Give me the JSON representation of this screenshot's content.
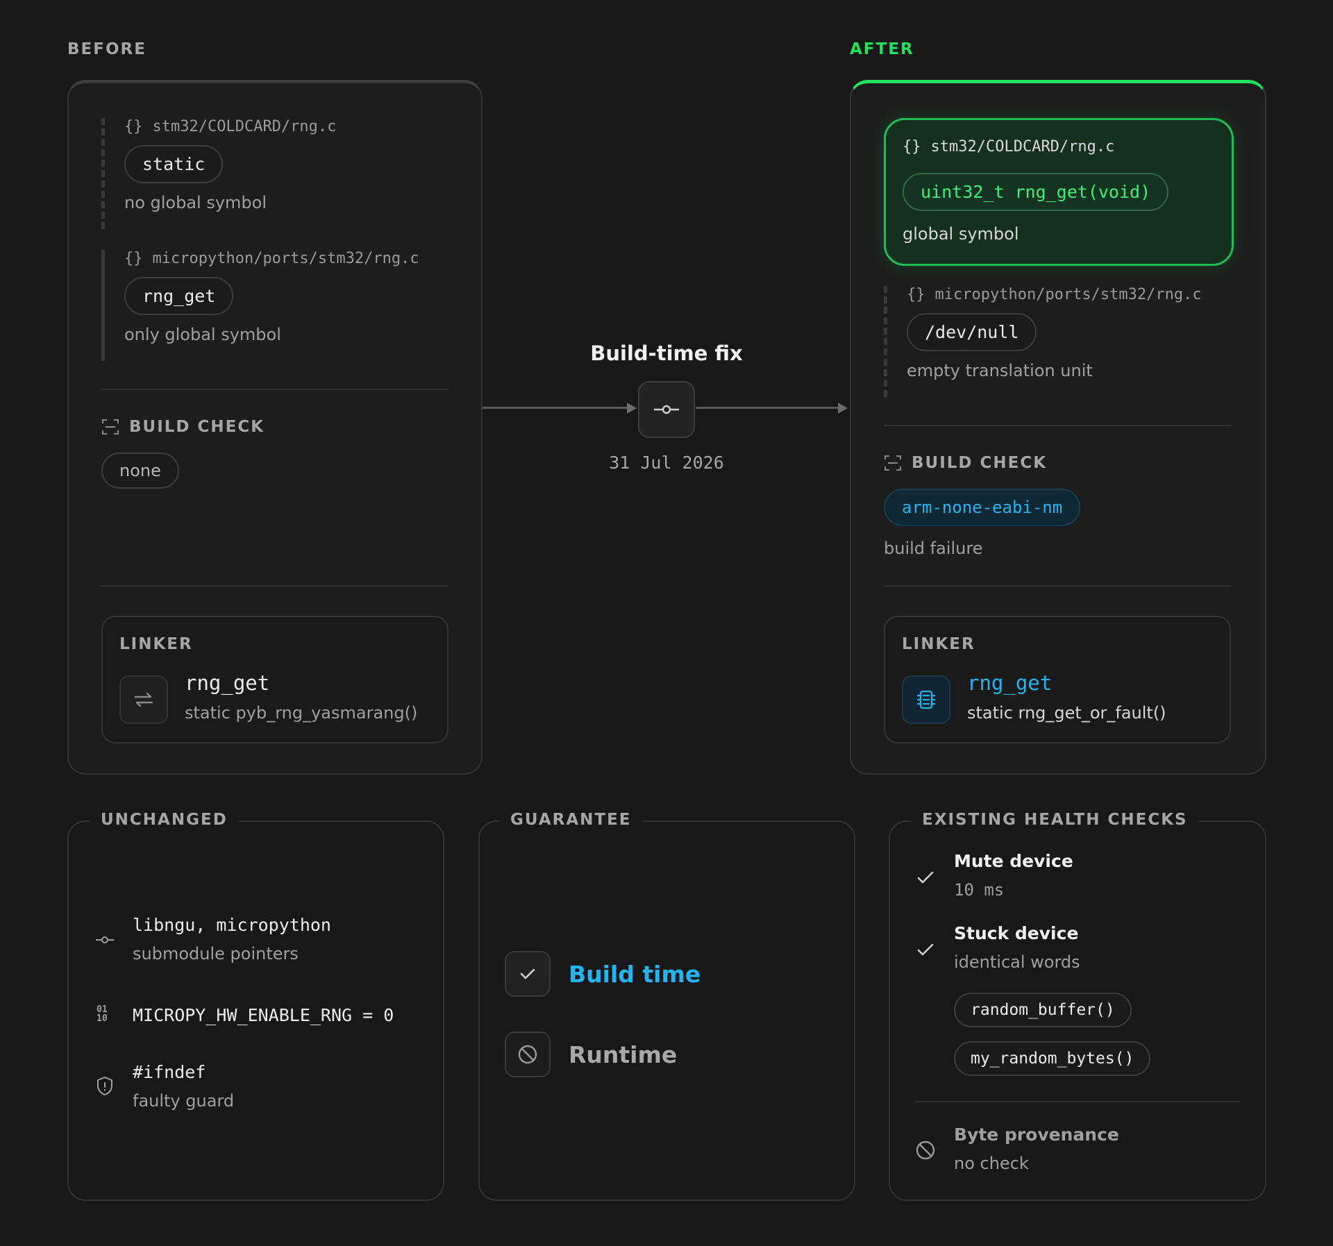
{
  "before": {
    "label": "BEFORE",
    "files": [
      {
        "path": "stm32/COLDCARD/rng.c",
        "icon": "braces-icon",
        "code": "static",
        "note": "no global symbol"
      },
      {
        "path": "micropython/ports/stm32/rng.c",
        "icon": "braces-icon",
        "code": "rng_get",
        "note": "only global symbol"
      }
    ],
    "build_check": {
      "title": "BUILD CHECK",
      "icon": "scan-icon",
      "value": "none"
    },
    "linker": {
      "title": "LINKER",
      "icon": "swap-arrows-icon",
      "symbol": "rng_get",
      "impl": "static pyb_rng_yasmarang()"
    }
  },
  "transition": {
    "title": "Build-time fix",
    "icon": "commit-icon",
    "date": "31 Jul 2026"
  },
  "after": {
    "label": "AFTER",
    "files": [
      {
        "path": "stm32/COLDCARD/rng.c",
        "icon": "braces-icon",
        "code": "uint32_t rng_get(void)",
        "note": "global symbol"
      },
      {
        "path": "micropython/ports/stm32/rng.c",
        "icon": "braces-icon",
        "code": "/dev/null",
        "note": "empty translation unit"
      }
    ],
    "build_check": {
      "title": "BUILD CHECK",
      "icon": "scan-icon",
      "value": "arm-none-eabi-nm",
      "note": "build failure"
    },
    "linker": {
      "title": "LINKER",
      "icon": "chip-icon",
      "symbol": "rng_get",
      "impl": "static rng_get_or_fault()"
    }
  },
  "unchanged": {
    "title": "UNCHANGED",
    "items": [
      {
        "icon": "commit-icon",
        "title": "libngu, micropython",
        "sub": "submodule pointers"
      },
      {
        "icon": "binary-icon",
        "title": "MICROPY_HW_ENABLE_RNG = 0",
        "sub": ""
      },
      {
        "icon": "shield-alert-icon",
        "title": "#ifndef",
        "sub": "faulty guard"
      }
    ]
  },
  "guarantee": {
    "title": "GUARANTEE",
    "items": [
      {
        "icon": "check-icon",
        "label": "Build time",
        "status": "yes"
      },
      {
        "icon": "ban-icon",
        "label": "Runtime",
        "status": "no"
      }
    ]
  },
  "health_checks": {
    "title": "EXISTING HEALTH CHECKS",
    "items": [
      {
        "icon": "check-icon",
        "title": "Mute device",
        "sub": "10 ms"
      },
      {
        "icon": "check-icon",
        "title": "Stuck device",
        "sub": "identical words",
        "functions": [
          "random_buffer()",
          "my_random_bytes()"
        ]
      }
    ],
    "missing": {
      "icon": "ban-icon",
      "title": "Byte provenance",
      "sub": "no check"
    }
  },
  "colors": {
    "accent_green": "#22e060",
    "accent_blue": "#25b4f0",
    "background": "#181818"
  }
}
